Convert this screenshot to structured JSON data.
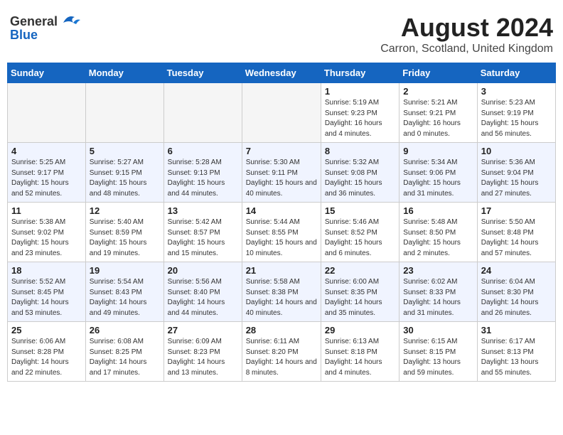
{
  "header": {
    "logo_general": "General",
    "logo_blue": "Blue",
    "month_title": "August 2024",
    "location": "Carron, Scotland, United Kingdom"
  },
  "weekdays": [
    "Sunday",
    "Monday",
    "Tuesday",
    "Wednesday",
    "Thursday",
    "Friday",
    "Saturday"
  ],
  "weeks": [
    [
      {
        "day": "",
        "empty": true
      },
      {
        "day": "",
        "empty": true
      },
      {
        "day": "",
        "empty": true
      },
      {
        "day": "",
        "empty": true
      },
      {
        "day": "1",
        "sunrise": "Sunrise: 5:19 AM",
        "sunset": "Sunset: 9:23 PM",
        "daylight": "Daylight: 16 hours and 4 minutes."
      },
      {
        "day": "2",
        "sunrise": "Sunrise: 5:21 AM",
        "sunset": "Sunset: 9:21 PM",
        "daylight": "Daylight: 16 hours and 0 minutes."
      },
      {
        "day": "3",
        "sunrise": "Sunrise: 5:23 AM",
        "sunset": "Sunset: 9:19 PM",
        "daylight": "Daylight: 15 hours and 56 minutes."
      }
    ],
    [
      {
        "day": "4",
        "sunrise": "Sunrise: 5:25 AM",
        "sunset": "Sunset: 9:17 PM",
        "daylight": "Daylight: 15 hours and 52 minutes."
      },
      {
        "day": "5",
        "sunrise": "Sunrise: 5:27 AM",
        "sunset": "Sunset: 9:15 PM",
        "daylight": "Daylight: 15 hours and 48 minutes."
      },
      {
        "day": "6",
        "sunrise": "Sunrise: 5:28 AM",
        "sunset": "Sunset: 9:13 PM",
        "daylight": "Daylight: 15 hours and 44 minutes."
      },
      {
        "day": "7",
        "sunrise": "Sunrise: 5:30 AM",
        "sunset": "Sunset: 9:11 PM",
        "daylight": "Daylight: 15 hours and 40 minutes."
      },
      {
        "day": "8",
        "sunrise": "Sunrise: 5:32 AM",
        "sunset": "Sunset: 9:08 PM",
        "daylight": "Daylight: 15 hours and 36 minutes."
      },
      {
        "day": "9",
        "sunrise": "Sunrise: 5:34 AM",
        "sunset": "Sunset: 9:06 PM",
        "daylight": "Daylight: 15 hours and 31 minutes."
      },
      {
        "day": "10",
        "sunrise": "Sunrise: 5:36 AM",
        "sunset": "Sunset: 9:04 PM",
        "daylight": "Daylight: 15 hours and 27 minutes."
      }
    ],
    [
      {
        "day": "11",
        "sunrise": "Sunrise: 5:38 AM",
        "sunset": "Sunset: 9:02 PM",
        "daylight": "Daylight: 15 hours and 23 minutes."
      },
      {
        "day": "12",
        "sunrise": "Sunrise: 5:40 AM",
        "sunset": "Sunset: 8:59 PM",
        "daylight": "Daylight: 15 hours and 19 minutes."
      },
      {
        "day": "13",
        "sunrise": "Sunrise: 5:42 AM",
        "sunset": "Sunset: 8:57 PM",
        "daylight": "Daylight: 15 hours and 15 minutes."
      },
      {
        "day": "14",
        "sunrise": "Sunrise: 5:44 AM",
        "sunset": "Sunset: 8:55 PM",
        "daylight": "Daylight: 15 hours and 10 minutes."
      },
      {
        "day": "15",
        "sunrise": "Sunrise: 5:46 AM",
        "sunset": "Sunset: 8:52 PM",
        "daylight": "Daylight: 15 hours and 6 minutes."
      },
      {
        "day": "16",
        "sunrise": "Sunrise: 5:48 AM",
        "sunset": "Sunset: 8:50 PM",
        "daylight": "Daylight: 15 hours and 2 minutes."
      },
      {
        "day": "17",
        "sunrise": "Sunrise: 5:50 AM",
        "sunset": "Sunset: 8:48 PM",
        "daylight": "Daylight: 14 hours and 57 minutes."
      }
    ],
    [
      {
        "day": "18",
        "sunrise": "Sunrise: 5:52 AM",
        "sunset": "Sunset: 8:45 PM",
        "daylight": "Daylight: 14 hours and 53 minutes."
      },
      {
        "day": "19",
        "sunrise": "Sunrise: 5:54 AM",
        "sunset": "Sunset: 8:43 PM",
        "daylight": "Daylight: 14 hours and 49 minutes."
      },
      {
        "day": "20",
        "sunrise": "Sunrise: 5:56 AM",
        "sunset": "Sunset: 8:40 PM",
        "daylight": "Daylight: 14 hours and 44 minutes."
      },
      {
        "day": "21",
        "sunrise": "Sunrise: 5:58 AM",
        "sunset": "Sunset: 8:38 PM",
        "daylight": "Daylight: 14 hours and 40 minutes."
      },
      {
        "day": "22",
        "sunrise": "Sunrise: 6:00 AM",
        "sunset": "Sunset: 8:35 PM",
        "daylight": "Daylight: 14 hours and 35 minutes."
      },
      {
        "day": "23",
        "sunrise": "Sunrise: 6:02 AM",
        "sunset": "Sunset: 8:33 PM",
        "daylight": "Daylight: 14 hours and 31 minutes."
      },
      {
        "day": "24",
        "sunrise": "Sunrise: 6:04 AM",
        "sunset": "Sunset: 8:30 PM",
        "daylight": "Daylight: 14 hours and 26 minutes."
      }
    ],
    [
      {
        "day": "25",
        "sunrise": "Sunrise: 6:06 AM",
        "sunset": "Sunset: 8:28 PM",
        "daylight": "Daylight: 14 hours and 22 minutes."
      },
      {
        "day": "26",
        "sunrise": "Sunrise: 6:08 AM",
        "sunset": "Sunset: 8:25 PM",
        "daylight": "Daylight: 14 hours and 17 minutes."
      },
      {
        "day": "27",
        "sunrise": "Sunrise: 6:09 AM",
        "sunset": "Sunset: 8:23 PM",
        "daylight": "Daylight: 14 hours and 13 minutes."
      },
      {
        "day": "28",
        "sunrise": "Sunrise: 6:11 AM",
        "sunset": "Sunset: 8:20 PM",
        "daylight": "Daylight: 14 hours and 8 minutes."
      },
      {
        "day": "29",
        "sunrise": "Sunrise: 6:13 AM",
        "sunset": "Sunset: 8:18 PM",
        "daylight": "Daylight: 14 hours and 4 minutes."
      },
      {
        "day": "30",
        "sunrise": "Sunrise: 6:15 AM",
        "sunset": "Sunset: 8:15 PM",
        "daylight": "Daylight: 13 hours and 59 minutes."
      },
      {
        "day": "31",
        "sunrise": "Sunrise: 6:17 AM",
        "sunset": "Sunset: 8:13 PM",
        "daylight": "Daylight: 13 hours and 55 minutes."
      }
    ]
  ]
}
